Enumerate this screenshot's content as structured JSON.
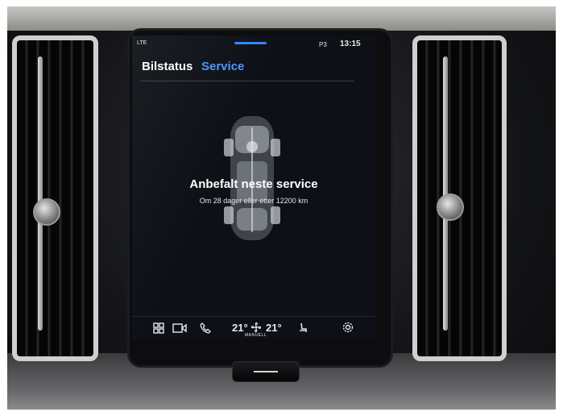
{
  "status_bar": {
    "signal": "LTE",
    "p3": "P3",
    "clock": "13:15"
  },
  "tabs": [
    {
      "label": "Bilstatus",
      "active": false
    },
    {
      "label": "Service",
      "active": true
    }
  ],
  "service": {
    "headline": "Anbefalt neste service",
    "detail": "Om 28 dager eller etter 12200 km"
  },
  "climate_bar": {
    "left_temp": "21°",
    "right_temp": "21°",
    "fan_mode": "MANUELL"
  },
  "icons": {
    "apps": "apps-grid-icon",
    "camera": "camera-icon",
    "phone": "phone-icon",
    "fan": "fan-icon",
    "seat": "seat-heat-icon",
    "settings": "settings-gear-icon"
  },
  "colors": {
    "accent": "#4b93ff",
    "screen_bg": "#0d1016"
  }
}
